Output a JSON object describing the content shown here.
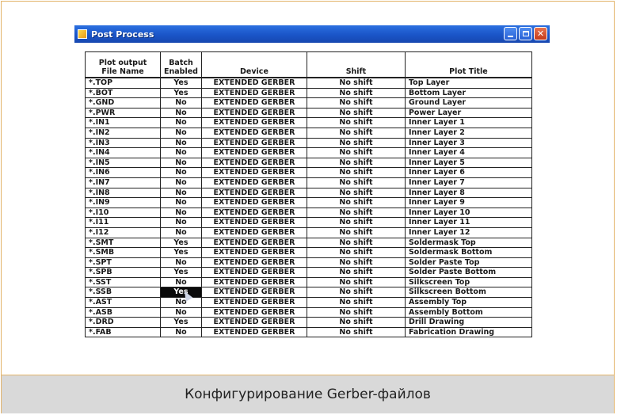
{
  "window": {
    "title": "Post Process",
    "icon": "app-icon",
    "buttons": [
      "minimize-icon",
      "maximize-icon",
      "close-icon"
    ]
  },
  "table": {
    "headers": {
      "file_name": [
        "Plot output",
        "File Name"
      ],
      "batch": [
        "Batch",
        "Enabled"
      ],
      "device": "Device",
      "shift": "Shift",
      "plot_title": "Plot Title"
    },
    "selected_row": 21,
    "rows": [
      {
        "file": "*.TOP",
        "batch": "Yes",
        "device": "EXTENDED GERBER",
        "shift": "No shift",
        "title": "Top Layer"
      },
      {
        "file": "*.BOT",
        "batch": "Yes",
        "device": "EXTENDED GERBER",
        "shift": "No shift",
        "title": "Bottom Layer"
      },
      {
        "file": "*.GND",
        "batch": "No",
        "device": "EXTENDED GERBER",
        "shift": "No shift",
        "title": "Ground Layer"
      },
      {
        "file": "*.PWR",
        "batch": "No",
        "device": "EXTENDED GERBER",
        "shift": "No shift",
        "title": "Power Layer"
      },
      {
        "file": "*.IN1",
        "batch": "No",
        "device": "EXTENDED GERBER",
        "shift": "No shift",
        "title": "Inner Layer 1"
      },
      {
        "file": "*.IN2",
        "batch": "No",
        "device": "EXTENDED GERBER",
        "shift": "No shift",
        "title": "Inner Layer 2"
      },
      {
        "file": "*.IN3",
        "batch": "No",
        "device": "EXTENDED GERBER",
        "shift": "No shift",
        "title": "Inner Layer 3"
      },
      {
        "file": "*.IN4",
        "batch": "No",
        "device": "EXTENDED GERBER",
        "shift": "No shift",
        "title": "Inner Layer 4"
      },
      {
        "file": "*.IN5",
        "batch": "No",
        "device": "EXTENDED GERBER",
        "shift": "No shift",
        "title": "Inner Layer 5"
      },
      {
        "file": "*.IN6",
        "batch": "No",
        "device": "EXTENDED GERBER",
        "shift": "No shift",
        "title": "Inner Layer 6"
      },
      {
        "file": "*.IN7",
        "batch": "No",
        "device": "EXTENDED GERBER",
        "shift": "No shift",
        "title": "Inner Layer 7"
      },
      {
        "file": "*.IN8",
        "batch": "No",
        "device": "EXTENDED GERBER",
        "shift": "No shift",
        "title": "Inner Layer 8"
      },
      {
        "file": "*.IN9",
        "batch": "No",
        "device": "EXTENDED GERBER",
        "shift": "No shift",
        "title": "Inner Layer 9"
      },
      {
        "file": "*.I10",
        "batch": "No",
        "device": "EXTENDED GERBER",
        "shift": "No shift",
        "title": "Inner Layer 10"
      },
      {
        "file": "*.I11",
        "batch": "No",
        "device": "EXTENDED GERBER",
        "shift": "No shift",
        "title": "Inner Layer 11"
      },
      {
        "file": "*.I12",
        "batch": "No",
        "device": "EXTENDED GERBER",
        "shift": "No shift",
        "title": "Inner Layer 12"
      },
      {
        "file": "*.SMT",
        "batch": "Yes",
        "device": "EXTENDED GERBER",
        "shift": "No shift",
        "title": "Soldermask Top"
      },
      {
        "file": "*.SMB",
        "batch": "Yes",
        "device": "EXTENDED GERBER",
        "shift": "No shift",
        "title": "Soldermask Bottom"
      },
      {
        "file": "*.SPT",
        "batch": "No",
        "device": "EXTENDED GERBER",
        "shift": "No shift",
        "title": "Solder Paste Top"
      },
      {
        "file": "*.SPB",
        "batch": "Yes",
        "device": "EXTENDED GERBER",
        "shift": "No shift",
        "title": "Solder Paste Bottom"
      },
      {
        "file": "*.SST",
        "batch": "No",
        "device": "EXTENDED GERBER",
        "shift": "No shift",
        "title": "Silkscreen Top"
      },
      {
        "file": "*.SSB",
        "batch": "Yes",
        "device": "EXTENDED GERBER",
        "shift": "No shift",
        "title": "Silkscreen Bottom"
      },
      {
        "file": "*.AST",
        "batch": "No",
        "device": "EXTENDED GERBER",
        "shift": "No shift",
        "title": "Assembly Top"
      },
      {
        "file": "*.ASB",
        "batch": "No",
        "device": "EXTENDED GERBER",
        "shift": "No shift",
        "title": "Assembly Bottom"
      },
      {
        "file": "*.DRD",
        "batch": "Yes",
        "device": "EXTENDED GERBER",
        "shift": "No shift",
        "title": "Drill Drawing"
      },
      {
        "file": "*.FAB",
        "batch": "No",
        "device": "EXTENDED GERBER",
        "shift": "No shift",
        "title": "Fabrication Drawing"
      }
    ]
  },
  "caption": "Конфигурирование Gerber-файлов",
  "colors": {
    "frame_border": "#e3b46a",
    "caption_bg": "#d9d9d9",
    "titlebar": "#1a55c8",
    "selection": "#0a0a0a"
  }
}
